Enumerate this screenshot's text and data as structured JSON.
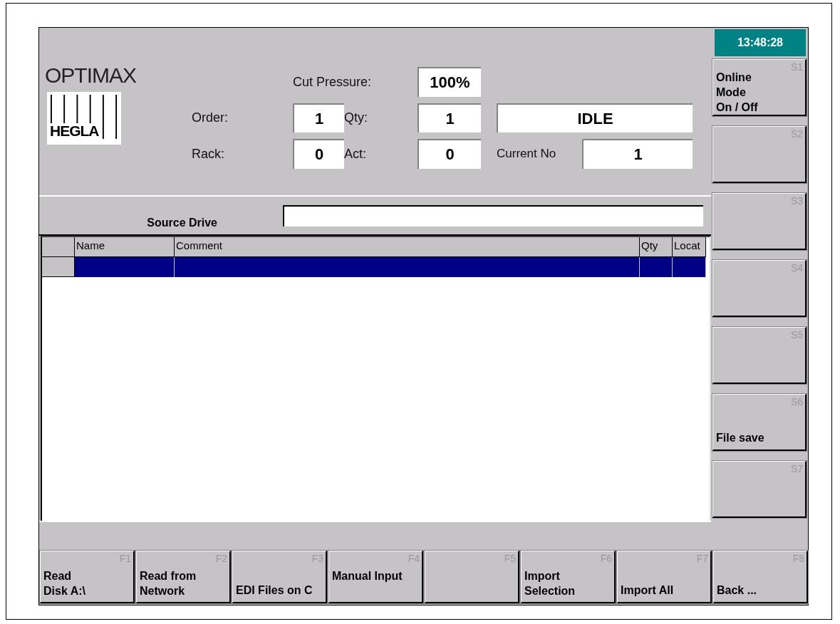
{
  "header": {
    "title": "OPTIMAX",
    "logo_text": "HEGLA",
    "cut_pressure": {
      "label": "Cut Pressure:",
      "value": "100%"
    },
    "order": {
      "label": "Order:",
      "value": "1"
    },
    "qty": {
      "label": "Qty:",
      "value": "1"
    },
    "rack": {
      "label": "Rack:",
      "value": "0"
    },
    "act": {
      "label": "Act:",
      "value": "0"
    },
    "status": "IDLE",
    "current_no": {
      "label": "Current No",
      "value": "1"
    }
  },
  "clock": "13:48:28",
  "side_keys": [
    {
      "key": "S1",
      "lines": [
        "Online",
        "Mode",
        "On / Off"
      ],
      "kind": "top"
    },
    {
      "key": "S2"
    },
    {
      "key": "S3"
    },
    {
      "key": "S4"
    },
    {
      "key": "S5"
    },
    {
      "key": "S6",
      "lines": [
        "File save"
      ],
      "kind": "bottom"
    },
    {
      "key": "S7"
    }
  ],
  "source_drive": {
    "label": "Source Drive"
  },
  "table": {
    "columns": [
      "Name",
      "Comment",
      "Qty",
      "Locat"
    ],
    "rows": [
      {
        "selected": true
      }
    ]
  },
  "function_keys": [
    {
      "key": "F1",
      "lines": [
        "Read",
        "Disk A:\\"
      ],
      "kind": "bottom"
    },
    {
      "key": "F2",
      "lines": [
        "Read from",
        "Network"
      ],
      "kind": "bottom"
    },
    {
      "key": "F3",
      "lines": [
        "EDI Files on C"
      ],
      "kind": "bottom"
    },
    {
      "key": "F4",
      "lines": [
        "Manual Input"
      ],
      "kind": "top"
    },
    {
      "key": "F5"
    },
    {
      "key": "F6",
      "lines": [
        "Import",
        "Selection"
      ],
      "kind": "bottom"
    },
    {
      "key": "F7",
      "lines": [
        "Import All"
      ],
      "kind": "bottom"
    },
    {
      "key": "F8",
      "lines": [
        "Back ..."
      ],
      "kind": "bottom"
    }
  ]
}
